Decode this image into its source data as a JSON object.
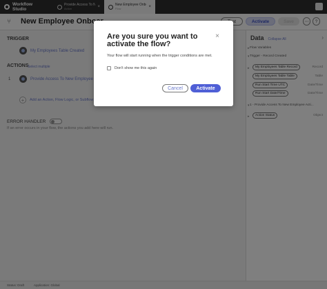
{
  "app": {
    "name": "Workflow Studio"
  },
  "tabs": [
    {
      "title": "Provide Access To New ...",
      "subtitle": "Action",
      "close": "×"
    },
    {
      "title": "New Employee Onboar...",
      "subtitle": "Flow",
      "close": "×"
    }
  ],
  "header": {
    "title": "New Employee Onboar...",
    "test_label": "Test",
    "activate_label": "Activate",
    "save_label": "Save",
    "more_label": "⋯",
    "help_label": "?"
  },
  "trigger": {
    "heading": "TRIGGER",
    "item_label": "My Employees Table Created"
  },
  "actions": {
    "heading": "ACTIONS",
    "select_multiple": "Select multiple",
    "steps": [
      {
        "number": "1",
        "label": "Provide Access To New Employee Acti..."
      }
    ],
    "add_label": "Add an Action, Flow Logic, or Subflow"
  },
  "error_handler": {
    "heading": "ERROR HANDLER",
    "description": "If an error occurs in your flow, the actions you add here will run."
  },
  "status": {
    "status": "Status: Draft",
    "application": "Application: Global"
  },
  "data_panel": {
    "title": "Data",
    "collapse_all": "Collapse All",
    "sections": [
      {
        "label": "Flow Variables"
      },
      {
        "label": "Trigger - Record Created"
      },
      {
        "label": "1 - Provide Access To New Employee Acti..."
      }
    ],
    "trigger_pills": [
      {
        "label": "My Employees Table Record",
        "type": "Record"
      },
      {
        "label": "My Employees Table Table",
        "type": "Table"
      },
      {
        "label": "Run Start Time UTC",
        "type": "Date/Time"
      },
      {
        "label": "Run Start Date/Time",
        "type": "Date/Time"
      }
    ],
    "action_pills": [
      {
        "label": "Action Status",
        "type": "Object"
      }
    ]
  },
  "modal": {
    "title": "Are you sure you want to activate the flow?",
    "message": "Your flow will start running when the trigger conditions are met.",
    "checkbox_label": "Don't show me this again",
    "cancel_label": "Cancel",
    "activate_label": "Activate",
    "close": "×"
  },
  "colors": {
    "accent": "#4f5fd6",
    "link": "#6b7acc",
    "topbar": "#2f2f2f"
  },
  "icons": [
    "workflow-logo-icon",
    "flow-icon",
    "tab-action-icon",
    "tab-flow-icon",
    "close-icon",
    "add-icon"
  ]
}
